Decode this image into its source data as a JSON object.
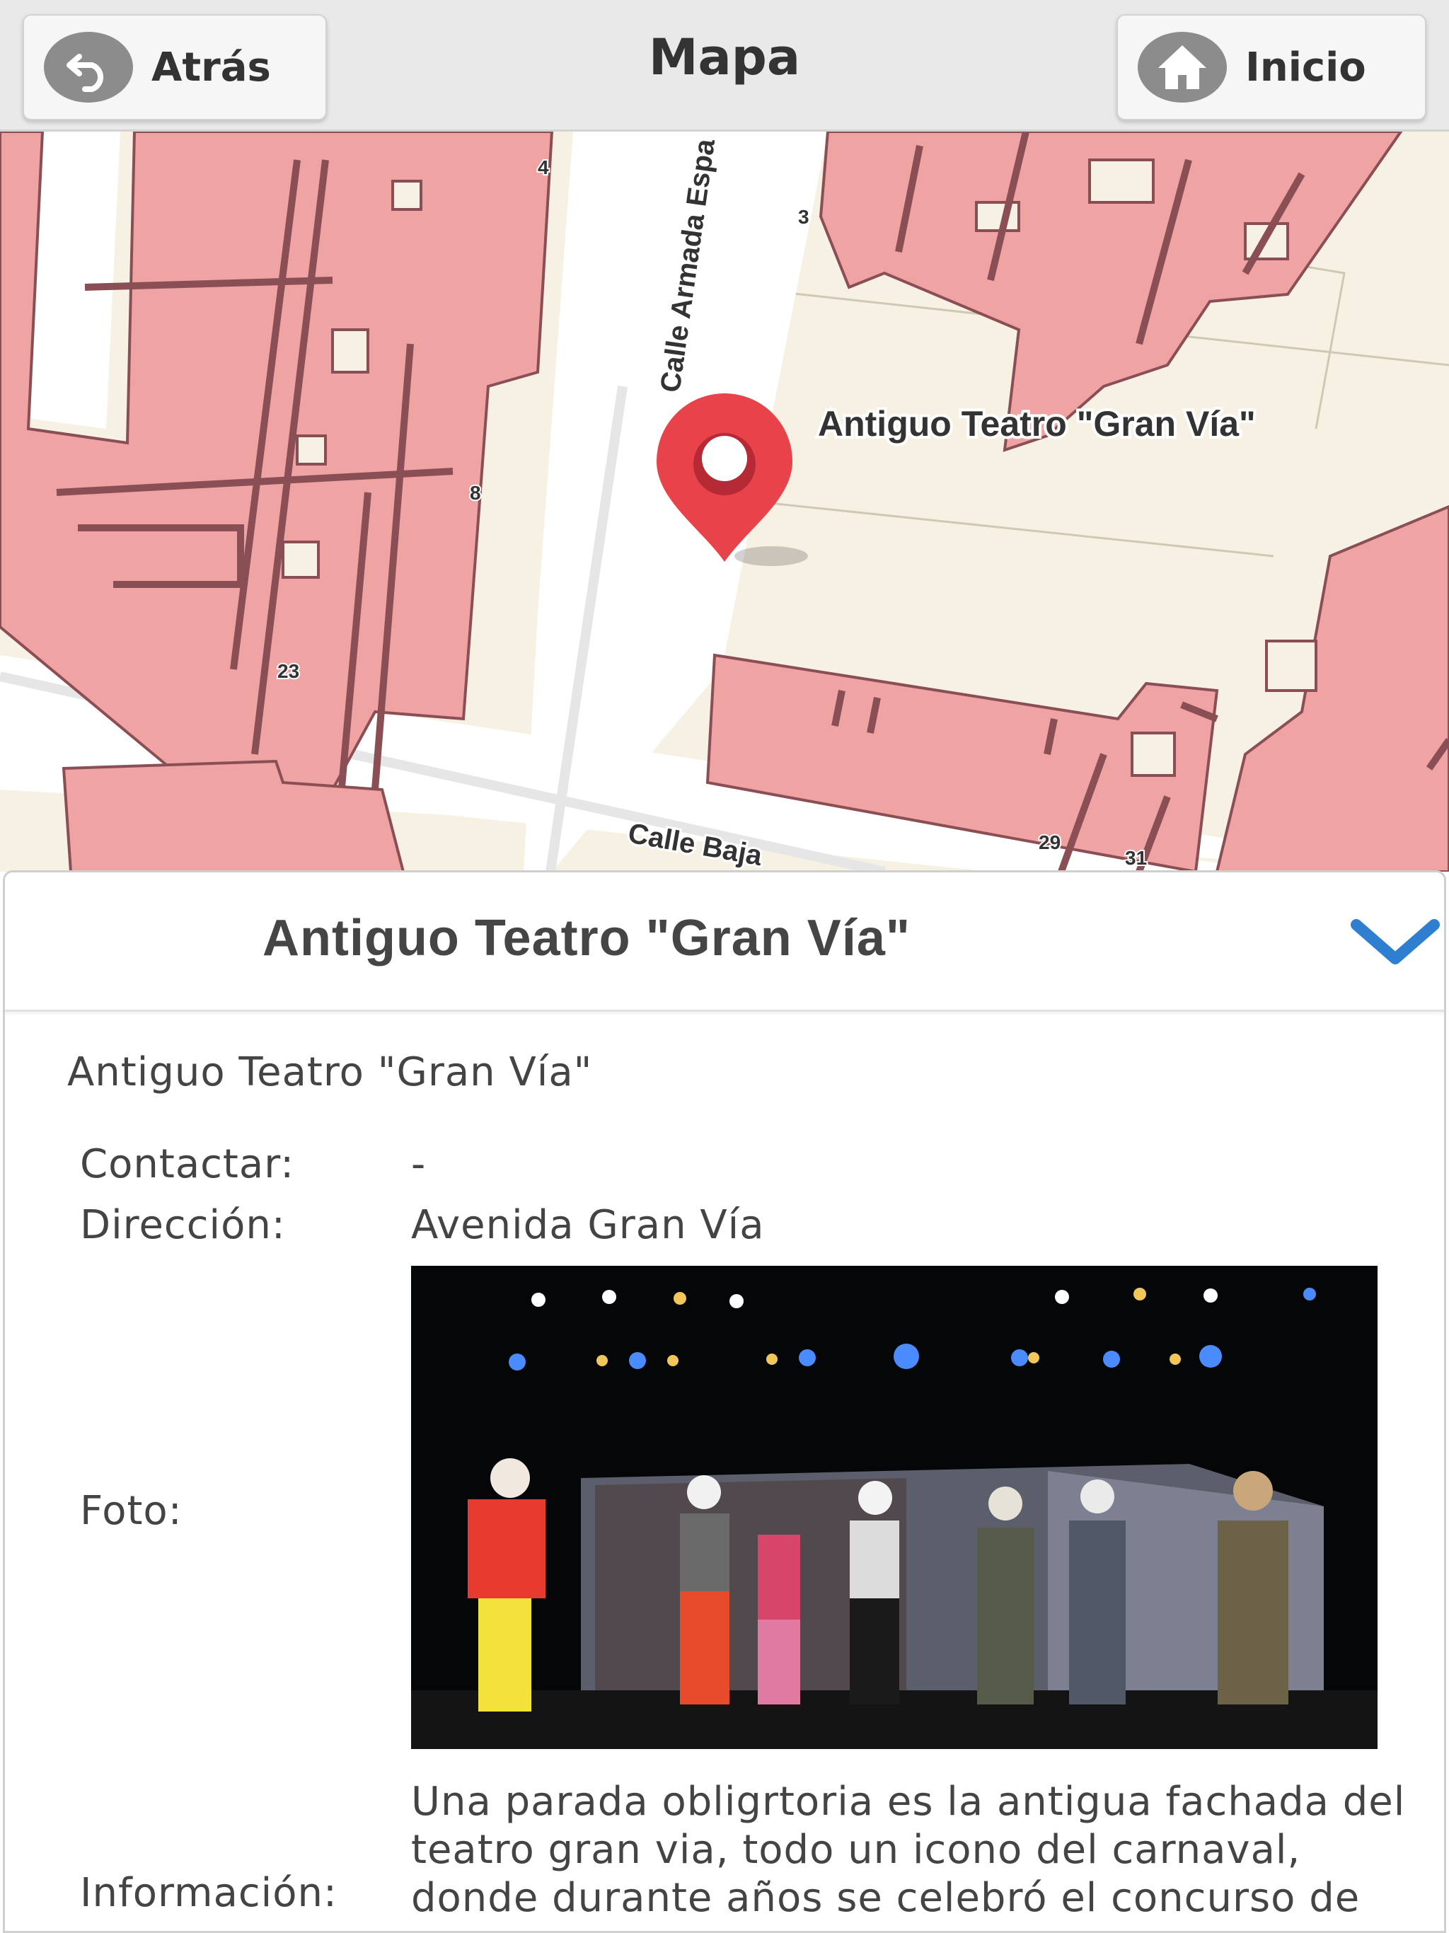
{
  "header": {
    "back_label": "Atrás",
    "title": "Mapa",
    "home_label": "Inicio"
  },
  "map": {
    "streets": [
      "Calle Armada Espa",
      "Calle Baja"
    ],
    "house_numbers": [
      "4",
      "3",
      "8",
      "23",
      "29",
      "31"
    ],
    "marker_label": "Antiguo Teatro \"Gran Vía\"",
    "colors": {
      "background": "#f6f1e3",
      "building": "#efa3a3",
      "building_edge": "#8a4f55",
      "road": "#ffffff",
      "marker": "#e8424a"
    }
  },
  "detail": {
    "title": "Antiguo Teatro \"Gran Vía\"",
    "subtitle": "Antiguo Teatro \"Gran Vía\"",
    "fields": {
      "contact_label": "Contactar:",
      "contact_value": "-",
      "address_label": "Dirección:",
      "address_value": "Avenida Gran Vía",
      "photo_label": "Foto:",
      "info_label": "Información:",
      "info_value": "Una parada obligrtoria es la antigua fachada del teatro gran via, todo un icono del carnaval, donde durante años se celebró el concurso de"
    },
    "chevron_icon": "chevron-down-icon",
    "accent_color": "#2f7fd0"
  }
}
